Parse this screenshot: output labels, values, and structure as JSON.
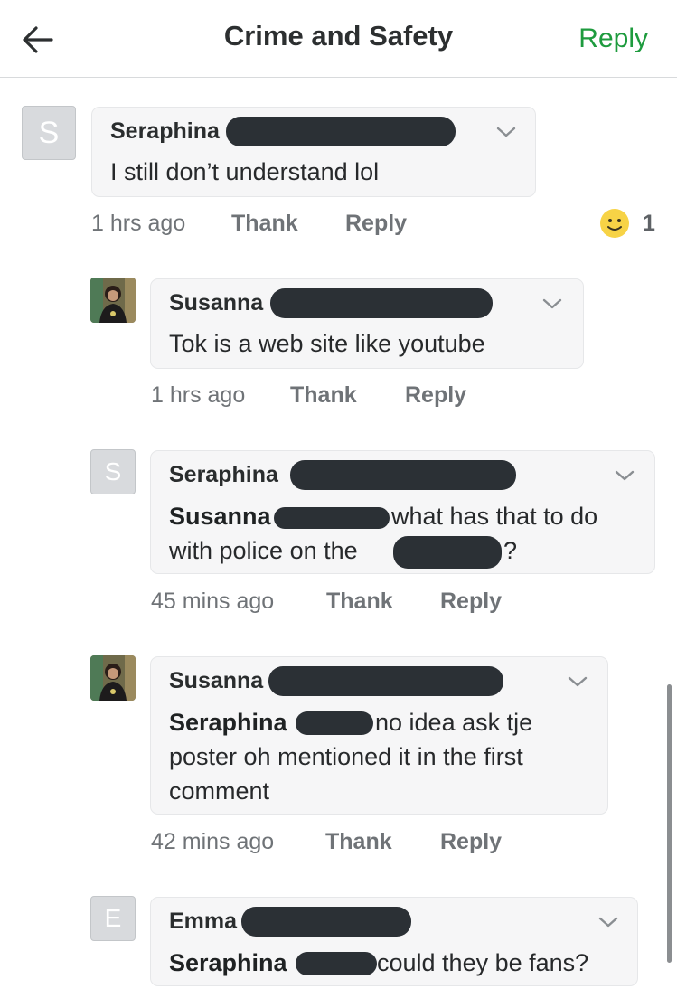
{
  "header": {
    "title": "Crime and Safety",
    "reply_label": "Reply"
  },
  "comments": [
    {
      "avatar_letter": "S",
      "author": "Seraphina",
      "text": "I still don’t understand lol",
      "time": "1 hrs ago",
      "thank": "Thank",
      "reply": "Reply",
      "reaction_count": "1"
    },
    {
      "author": "Susanna",
      "text": "Tok is a web site like youtube",
      "time": "1 hrs ago",
      "thank": "Thank",
      "reply": "Reply"
    },
    {
      "avatar_letter": "S",
      "author": "Seraphina",
      "mention": "Susanna",
      "text_line1": "what has that to do",
      "text_line2a": "with police on the",
      "text_line2b": "?",
      "time": "45 mins ago",
      "thank": "Thank",
      "reply": "Reply"
    },
    {
      "author": "Susanna",
      "mention": "Seraphina",
      "text_line1": "no idea ask tje",
      "text_line2": "poster oh mentioned it in the first",
      "text_line3": "comment",
      "time": "42 mins ago",
      "thank": "Thank",
      "reply": "Reply"
    },
    {
      "avatar_letter": "E",
      "author": "Emma",
      "mention": "Seraphina",
      "text": "could they be fans?"
    }
  ],
  "colors": {
    "accent_green": "#1e9b3e",
    "redaction": "#2b3035"
  }
}
